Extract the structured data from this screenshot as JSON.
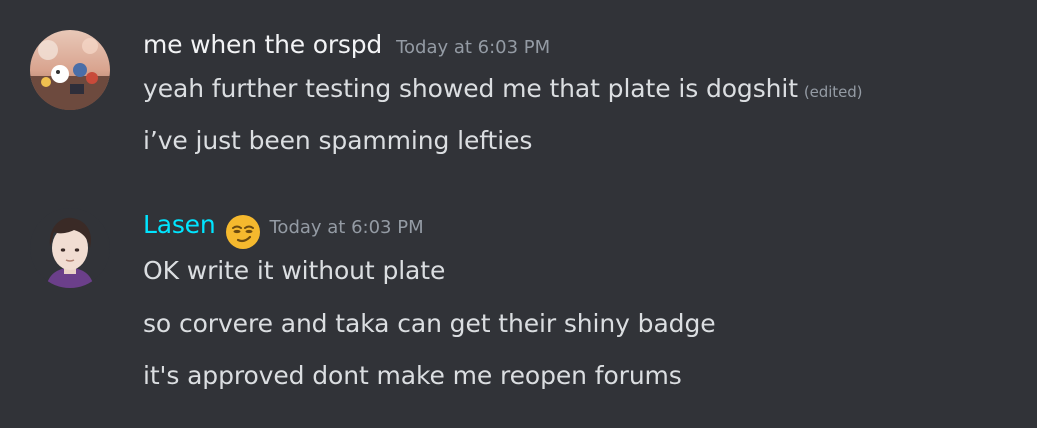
{
  "messages": [
    {
      "author": "me when the orspd",
      "author_color": "#f2f3f5",
      "timestamp": "Today at 6:03 PM",
      "lines": [
        {
          "text": "yeah further testing showed me that plate is dogshit",
          "edited_label": "(edited)"
        },
        {
          "text": "i’ve just been spamming lefties"
        }
      ]
    },
    {
      "author": "Lasen",
      "author_color": "#00e5ff",
      "role_icon": "smirking-face-emoji",
      "timestamp": "Today at 6:03 PM",
      "lines": [
        {
          "text": "OK write it without plate"
        },
        {
          "text": "so corvere and taka can get their shiny badge"
        },
        {
          "text": "it's approved dont make me reopen forums"
        }
      ]
    }
  ],
  "colors": {
    "background": "#313338",
    "message_text": "#dbdee1",
    "muted_text": "#949ba4"
  }
}
